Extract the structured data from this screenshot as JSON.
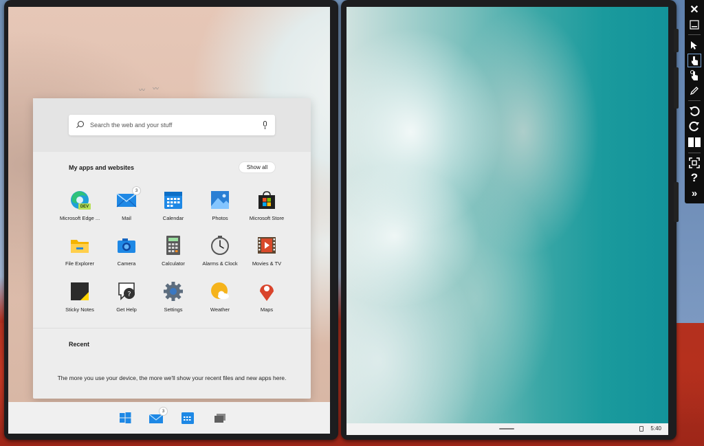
{
  "search": {
    "placeholder": "Search the web and your stuff"
  },
  "apps_section": {
    "title": "My apps and websites",
    "show_all": "Show all"
  },
  "apps": [
    {
      "label": "Microsoft Edge ...",
      "icon": "edge-dev-icon"
    },
    {
      "label": "Mail",
      "icon": "mail-icon",
      "badge": "3"
    },
    {
      "label": "Calendar",
      "icon": "calendar-icon"
    },
    {
      "label": "Photos",
      "icon": "photos-icon"
    },
    {
      "label": "Microsoft Store",
      "icon": "store-icon"
    },
    {
      "label": "File Explorer",
      "icon": "folder-icon"
    },
    {
      "label": "Camera",
      "icon": "camera-icon"
    },
    {
      "label": "Calculator",
      "icon": "calculator-icon"
    },
    {
      "label": "Alarms & Clock",
      "icon": "clock-icon"
    },
    {
      "label": "Movies & TV",
      "icon": "film-icon"
    },
    {
      "label": "Sticky Notes",
      "icon": "sticky-note-icon"
    },
    {
      "label": "Get Help",
      "icon": "help-icon"
    },
    {
      "label": "Settings",
      "icon": "gear-icon"
    },
    {
      "label": "Weather",
      "icon": "weather-icon"
    },
    {
      "label": "Maps",
      "icon": "map-pin-icon"
    }
  ],
  "recent": {
    "title": "Recent",
    "message": "The more you use your device, the more we'll show your recent files and new apps here."
  },
  "dev_badge": "DEV",
  "taskbar": {
    "mail_badge": "3"
  },
  "status": {
    "time": "5:40"
  },
  "colors": {
    "accent": "#0078d4",
    "panel": "#ededed",
    "toolbar": "#0e0e0e"
  }
}
